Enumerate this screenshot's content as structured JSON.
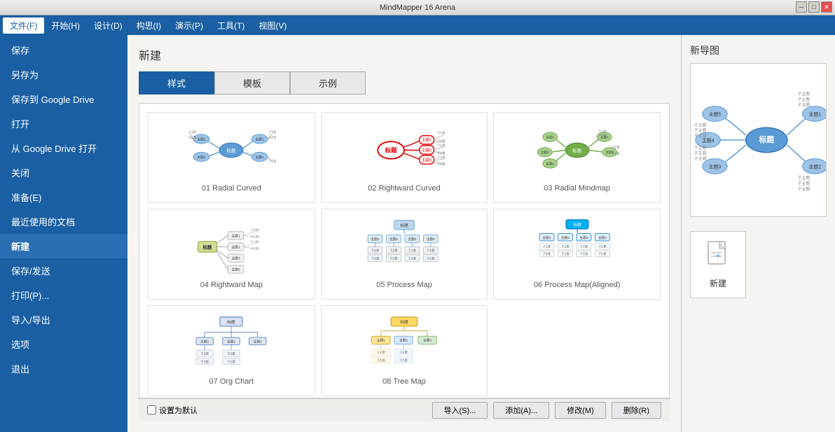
{
  "titleBar": {
    "title": "MindMapper 16 Arena"
  },
  "menuBar": {
    "items": [
      {
        "label": "文件(F)",
        "active": true
      },
      {
        "label": "开始(H)",
        "active": false
      },
      {
        "label": "设计(D)",
        "active": false
      },
      {
        "label": "构思(I)",
        "active": false
      },
      {
        "label": "演示(P)",
        "active": false
      },
      {
        "label": "工具(T)",
        "active": false
      },
      {
        "label": "视图(V)",
        "active": false
      }
    ]
  },
  "sidebar": {
    "items": [
      {
        "label": "保存",
        "active": false
      },
      {
        "label": "另存为",
        "active": false
      },
      {
        "label": "保存到 Google Drive",
        "active": false
      },
      {
        "label": "打开",
        "active": false
      },
      {
        "label": "从 Google Drive 打开",
        "active": false
      },
      {
        "label": "关闭",
        "active": false
      },
      {
        "label": "准备(E)",
        "active": false
      },
      {
        "label": "最近使用的文档",
        "active": false
      },
      {
        "label": "新建",
        "active": true
      },
      {
        "label": "保存/发送",
        "active": false
      },
      {
        "label": "打印(P)...",
        "active": false
      },
      {
        "label": "导入/导出",
        "active": false
      },
      {
        "label": "选项",
        "active": false
      },
      {
        "label": "退出",
        "active": false
      }
    ]
  },
  "newPanel": {
    "title": "新建",
    "tabs": [
      {
        "label": "样式",
        "active": true
      },
      {
        "label": "模板",
        "active": false
      },
      {
        "label": "示例",
        "active": false
      }
    ],
    "cards": [
      {
        "id": "01",
        "label": "01 Radial Curved"
      },
      {
        "id": "02",
        "label": "02 Rightward Curved"
      },
      {
        "id": "03",
        "label": "03 Radial Mindmap"
      },
      {
        "id": "04",
        "label": "04 Rightward Map"
      },
      {
        "id": "05",
        "label": "05 Process Map"
      },
      {
        "id": "06",
        "label": "06 Process Map(Aligned)"
      },
      {
        "id": "07",
        "label": "07 Org Chart"
      },
      {
        "id": "08",
        "label": "08 Tree Map"
      }
    ]
  },
  "bottomBar": {
    "checkLabel": "设置为默认",
    "buttons": [
      {
        "label": "导入(S)..."
      },
      {
        "label": "添加(A)..."
      },
      {
        "label": "修改(M)"
      },
      {
        "label": "删除(R)"
      }
    ]
  },
  "rightPanel": {
    "previewTitle": "新导图",
    "newFileLabel": "新建"
  }
}
